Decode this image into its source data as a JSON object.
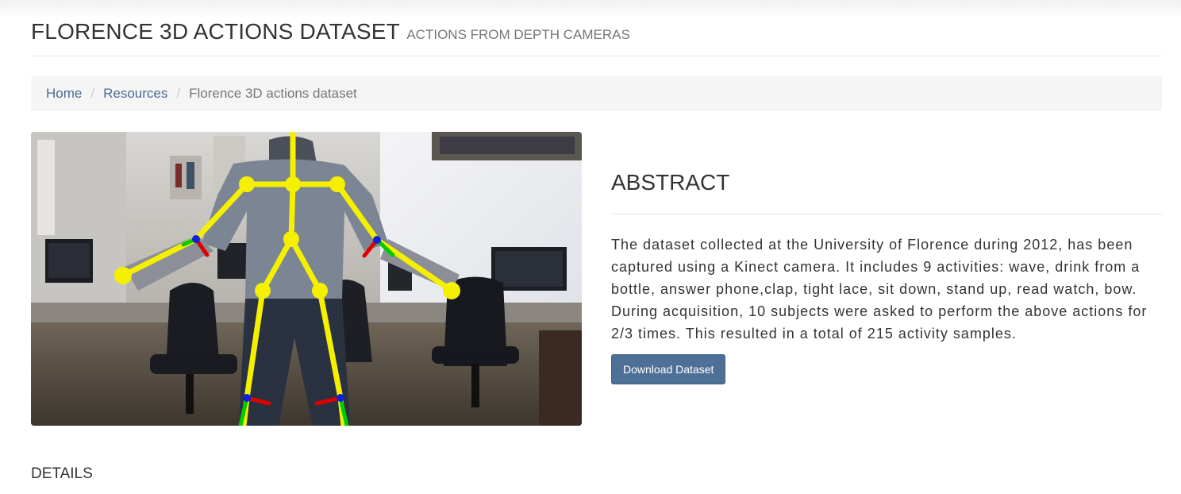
{
  "header": {
    "title": "FLORENCE 3D ACTIONS DATASET",
    "subtitle": "ACTIONS FROM DEPTH CAMERAS"
  },
  "breadcrumb": {
    "items": [
      {
        "label": "Home"
      },
      {
        "label": "Resources"
      },
      {
        "label": "Florence 3D actions dataset"
      }
    ]
  },
  "abstract": {
    "heading": "ABSTRACT",
    "text": "The dataset collected at the University of Florence during 2012, has been captured using a Kinect camera. It includes 9 activities: wave, drink from a bottle, answer phone,clap, tight lace, sit down, stand up, read watch, bow. During acquisition, 10 subjects were asked to perform the above actions for 2/3 times. This resulted in a total of 215 activity samples.",
    "button_label": "Download Dataset"
  },
  "details": {
    "heading": "DETAILS"
  },
  "colors": {
    "link": "#4a6c94",
    "button": "#4e7096",
    "skeleton": "#f5f000"
  }
}
